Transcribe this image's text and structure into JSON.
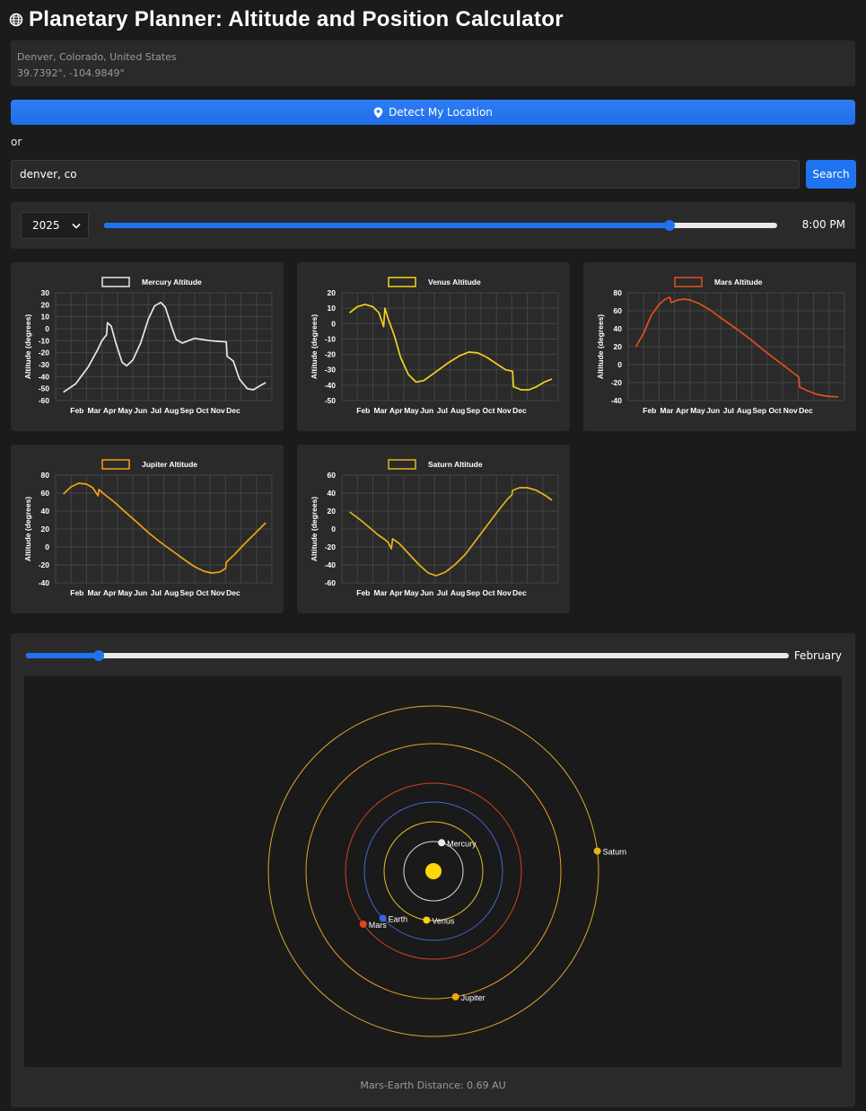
{
  "header": {
    "title": "Planetary Planner: Altitude and Position Calculator"
  },
  "location": {
    "name": "Denver, Colorado, United States",
    "coords": "39.7392°, -104.9849°"
  },
  "detect_button": {
    "label": "Detect My Location"
  },
  "or_text": "or",
  "search": {
    "value": "denver, co",
    "button_label": "Search"
  },
  "controls": {
    "year": "2025",
    "time_label": "8:00 PM",
    "time_slider_progress": 0.84
  },
  "months": [
    "Feb",
    "Mar",
    "Apr",
    "May",
    "Jun",
    "Jul",
    "Aug",
    "Sep",
    "Oct",
    "Nov",
    "Dec"
  ],
  "chart_data": [
    {
      "type": "line",
      "legend": "Mercury Altitude",
      "ylabel": "Altitude (degrees)",
      "color": "#e8e8e8",
      "ylim": [
        -60,
        30
      ],
      "yticks": [
        30,
        20,
        10,
        0,
        -10,
        -20,
        -30,
        -40,
        -50,
        -60
      ],
      "points": [
        [
          0.5,
          -53
        ],
        [
          1.3,
          -46
        ],
        [
          2.1,
          -32
        ],
        [
          2.7,
          -18
        ],
        [
          3.0,
          -10
        ],
        [
          3.3,
          -5
        ],
        [
          3.35,
          5
        ],
        [
          3.6,
          2
        ],
        [
          3.9,
          -12
        ],
        [
          4.3,
          -28
        ],
        [
          4.6,
          -31
        ],
        [
          5.0,
          -26
        ],
        [
          5.5,
          -12
        ],
        [
          6.0,
          8
        ],
        [
          6.4,
          19
        ],
        [
          6.8,
          22
        ],
        [
          7.1,
          18
        ],
        [
          7.5,
          2
        ],
        [
          7.8,
          -9
        ],
        [
          8.2,
          -12
        ],
        [
          8.6,
          -10
        ],
        [
          9.0,
          -8
        ],
        [
          9.5,
          -9
        ],
        [
          10.0,
          -10
        ],
        [
          10.5,
          -10.5
        ],
        [
          11.05,
          -11
        ],
        [
          11.1,
          -23
        ],
        [
          11.5,
          -27
        ],
        [
          11.9,
          -42
        ],
        [
          12.4,
          -50
        ],
        [
          12.8,
          -51
        ],
        [
          13.3,
          -47
        ],
        [
          13.6,
          -45
        ]
      ]
    },
    {
      "type": "line",
      "legend": "Venus Altitude",
      "ylabel": "Altitude (degrees)",
      "color": "#f1d21b",
      "ylim": [
        -50,
        20
      ],
      "yticks": [
        20,
        10,
        0,
        -10,
        -20,
        -30,
        -40,
        -50
      ],
      "points": [
        [
          0.5,
          7
        ],
        [
          1.0,
          11
        ],
        [
          1.5,
          12.5
        ],
        [
          2.0,
          11
        ],
        [
          2.4,
          7
        ],
        [
          2.6,
          1
        ],
        [
          2.7,
          -2
        ],
        [
          2.78,
          10
        ],
        [
          3.0,
          3
        ],
        [
          3.4,
          -8
        ],
        [
          3.8,
          -22
        ],
        [
          4.3,
          -33
        ],
        [
          4.8,
          -38
        ],
        [
          5.3,
          -37
        ],
        [
          6.0,
          -32
        ],
        [
          6.8,
          -26
        ],
        [
          7.6,
          -21
        ],
        [
          8.2,
          -18.5
        ],
        [
          8.8,
          -19
        ],
        [
          9.4,
          -22
        ],
        [
          10.0,
          -26
        ],
        [
          10.6,
          -30
        ],
        [
          11.05,
          -31
        ],
        [
          11.1,
          -41
        ],
        [
          11.6,
          -43
        ],
        [
          12.1,
          -43
        ],
        [
          12.6,
          -41
        ],
        [
          13.1,
          -38
        ],
        [
          13.6,
          -36
        ]
      ]
    },
    {
      "type": "line",
      "legend": "Mars Altitude",
      "ylabel": "Altitude (degrees)",
      "color": "#e2501d",
      "ylim": [
        -40,
        80
      ],
      "yticks": [
        80,
        60,
        40,
        20,
        0,
        -20,
        -40
      ],
      "points": [
        [
          0.5,
          20
        ],
        [
          1.0,
          35
        ],
        [
          1.5,
          55
        ],
        [
          2.0,
          67
        ],
        [
          2.4,
          73
        ],
        [
          2.7,
          75
        ],
        [
          2.78,
          69
        ],
        [
          3.2,
          72
        ],
        [
          3.6,
          73
        ],
        [
          4.0,
          72
        ],
        [
          4.6,
          68
        ],
        [
          5.3,
          61
        ],
        [
          6.0,
          52
        ],
        [
          7.0,
          40
        ],
        [
          8.0,
          27
        ],
        [
          9.0,
          13
        ],
        [
          10.0,
          0
        ],
        [
          10.6,
          -8
        ],
        [
          11.05,
          -14
        ],
        [
          11.1,
          -25
        ],
        [
          11.6,
          -29
        ],
        [
          12.2,
          -33
        ],
        [
          12.8,
          -35
        ],
        [
          13.6,
          -36
        ]
      ]
    },
    {
      "type": "line",
      "legend": "Jupiter Altitude",
      "ylabel": "Altitude (degrees)",
      "color": "#f1a313",
      "ylim": [
        -40,
        80
      ],
      "yticks": [
        80,
        60,
        40,
        20,
        0,
        -20,
        -40
      ],
      "points": [
        [
          0.5,
          59
        ],
        [
          1.0,
          67
        ],
        [
          1.5,
          71
        ],
        [
          2.0,
          70
        ],
        [
          2.4,
          66
        ],
        [
          2.75,
          57
        ],
        [
          2.8,
          64
        ],
        [
          3.2,
          58
        ],
        [
          3.8,
          50
        ],
        [
          4.5,
          39
        ],
        [
          5.3,
          27
        ],
        [
          6.0,
          16
        ],
        [
          6.8,
          5
        ],
        [
          7.6,
          -5
        ],
        [
          8.4,
          -15
        ],
        [
          9.0,
          -22
        ],
        [
          9.6,
          -27
        ],
        [
          10.1,
          -29
        ],
        [
          10.6,
          -28
        ],
        [
          11.0,
          -24
        ],
        [
          11.05,
          -17
        ],
        [
          11.6,
          -8
        ],
        [
          12.2,
          3
        ],
        [
          12.9,
          15
        ],
        [
          13.6,
          27
        ]
      ]
    },
    {
      "type": "line",
      "legend": "Saturn Altitude",
      "ylabel": "Altitude (degrees)",
      "color": "#e6b21e",
      "ylim": [
        -60,
        60
      ],
      "yticks": [
        60,
        40,
        20,
        0,
        -20,
        -40,
        -60
      ],
      "points": [
        [
          0.5,
          19
        ],
        [
          1.2,
          10
        ],
        [
          1.9,
          0
        ],
        [
          2.3,
          -6
        ],
        [
          2.8,
          -12
        ],
        [
          3.0,
          -15
        ],
        [
          3.2,
          -22
        ],
        [
          3.28,
          -11
        ],
        [
          3.7,
          -16
        ],
        [
          4.3,
          -27
        ],
        [
          5.0,
          -40
        ],
        [
          5.6,
          -49
        ],
        [
          6.1,
          -52
        ],
        [
          6.7,
          -48
        ],
        [
          7.3,
          -40
        ],
        [
          8.0,
          -28
        ],
        [
          8.7,
          -12
        ],
        [
          9.4,
          4
        ],
        [
          10.1,
          20
        ],
        [
          10.7,
          33
        ],
        [
          11.0,
          38
        ],
        [
          11.05,
          43
        ],
        [
          11.5,
          46
        ],
        [
          12.0,
          46
        ],
        [
          12.6,
          43
        ],
        [
          13.2,
          37
        ],
        [
          13.6,
          32
        ]
      ]
    }
  ],
  "orbits": {
    "month_label": "February",
    "month_slider_progress": 0.095,
    "distance_text": "Mars-Earth Distance: 0.69 AU",
    "planets": [
      {
        "name": "Mercury",
        "color": "#e8e8e8",
        "orbit_color": "#d9d9d9",
        "orbit_r": 33,
        "angle_deg": 74
      },
      {
        "name": "Venus",
        "color": "#f1d21b",
        "orbit_color": "#e0c025",
        "orbit_r": 55,
        "angle_deg": -98
      },
      {
        "name": "Earth",
        "color": "#3e64d8",
        "orbit_color": "#4466d0",
        "orbit_r": 77,
        "angle_deg": -137
      },
      {
        "name": "Mars",
        "color": "#e2431d",
        "orbit_color": "#d0451d",
        "orbit_r": 98,
        "angle_deg": -143
      },
      {
        "name": "Jupiter",
        "color": "#f1a313",
        "orbit_color": "#e8a020",
        "orbit_r": 142,
        "angle_deg": -80
      },
      {
        "name": "Saturn",
        "color": "#e6b21e",
        "orbit_color": "#d9a830",
        "orbit_r": 184,
        "angle_deg": 7
      }
    ]
  }
}
